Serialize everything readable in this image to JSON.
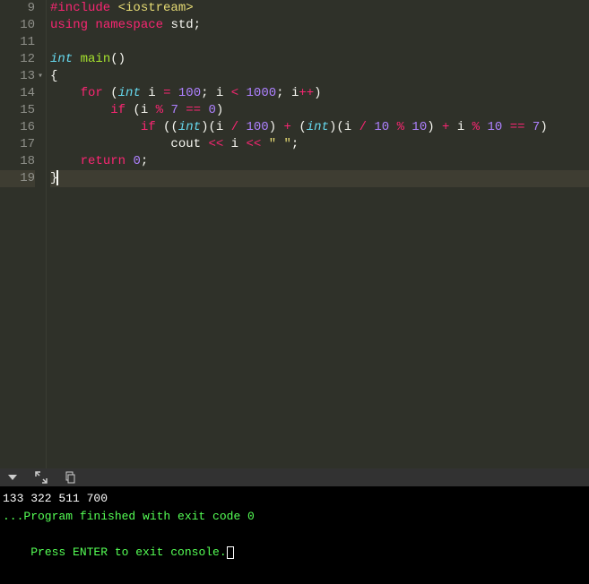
{
  "editor": {
    "lines": [
      {
        "num": "9",
        "tokens": [
          [
            "tok-preproc",
            "#include "
          ],
          [
            "tok-include",
            "<iostream>"
          ]
        ]
      },
      {
        "num": "10",
        "tokens": [
          [
            "tok-keyword2",
            "using"
          ],
          [
            "tok-punct",
            " "
          ],
          [
            "tok-keyword2",
            "namespace"
          ],
          [
            "tok-punct",
            " "
          ],
          [
            "tok-ident",
            "std"
          ],
          [
            "tok-punct",
            ";"
          ]
        ]
      },
      {
        "num": "11",
        "tokens": []
      },
      {
        "num": "12",
        "tokens": [
          [
            "tok-type",
            "int"
          ],
          [
            "tok-punct",
            " "
          ],
          [
            "tok-func",
            "main"
          ],
          [
            "tok-punct",
            "()"
          ]
        ]
      },
      {
        "num": "13",
        "fold": true,
        "tokens": [
          [
            "tok-punct",
            "{"
          ]
        ]
      },
      {
        "num": "14",
        "tokens": [
          [
            "tok-punct",
            "    "
          ],
          [
            "tok-keyword2",
            "for"
          ],
          [
            "tok-punct",
            " ("
          ],
          [
            "tok-type",
            "int"
          ],
          [
            "tok-punct",
            " i "
          ],
          [
            "tok-operator",
            "="
          ],
          [
            "tok-punct",
            " "
          ],
          [
            "tok-number",
            "100"
          ],
          [
            "tok-punct",
            "; i "
          ],
          [
            "tok-operator",
            "<"
          ],
          [
            "tok-punct",
            " "
          ],
          [
            "tok-number",
            "1000"
          ],
          [
            "tok-punct",
            "; i"
          ],
          [
            "tok-operator",
            "++"
          ],
          [
            "tok-punct",
            ")"
          ]
        ]
      },
      {
        "num": "15",
        "tokens": [
          [
            "tok-punct",
            "        "
          ],
          [
            "tok-keyword2",
            "if"
          ],
          [
            "tok-punct",
            " (i "
          ],
          [
            "tok-operator",
            "%"
          ],
          [
            "tok-punct",
            " "
          ],
          [
            "tok-number",
            "7"
          ],
          [
            "tok-punct",
            " "
          ],
          [
            "tok-operator",
            "=="
          ],
          [
            "tok-punct",
            " "
          ],
          [
            "tok-number",
            "0"
          ],
          [
            "tok-punct",
            ")"
          ]
        ]
      },
      {
        "num": "16",
        "tokens": [
          [
            "tok-punct",
            "            "
          ],
          [
            "tok-keyword2",
            "if"
          ],
          [
            "tok-punct",
            " (("
          ],
          [
            "tok-type",
            "int"
          ],
          [
            "tok-punct",
            ")(i "
          ],
          [
            "tok-operator",
            "/"
          ],
          [
            "tok-punct",
            " "
          ],
          [
            "tok-number",
            "100"
          ],
          [
            "tok-punct",
            ") "
          ],
          [
            "tok-operator",
            "+"
          ],
          [
            "tok-punct",
            " ("
          ],
          [
            "tok-type",
            "int"
          ],
          [
            "tok-punct",
            ")(i "
          ],
          [
            "tok-operator",
            "/"
          ],
          [
            "tok-punct",
            " "
          ],
          [
            "tok-number",
            "10"
          ],
          [
            "tok-punct",
            " "
          ],
          [
            "tok-operator",
            "%"
          ],
          [
            "tok-punct",
            " "
          ],
          [
            "tok-number",
            "10"
          ],
          [
            "tok-punct",
            ") "
          ],
          [
            "tok-operator",
            "+"
          ],
          [
            "tok-punct",
            " i "
          ],
          [
            "tok-operator",
            "%"
          ],
          [
            "tok-punct",
            " "
          ],
          [
            "tok-number",
            "10"
          ],
          [
            "tok-punct",
            " "
          ],
          [
            "tok-operator",
            "=="
          ],
          [
            "tok-punct",
            " "
          ],
          [
            "tok-number",
            "7"
          ],
          [
            "tok-punct",
            ")"
          ]
        ]
      },
      {
        "num": "17",
        "tokens": [
          [
            "tok-punct",
            "                cout "
          ],
          [
            "tok-operator",
            "<<"
          ],
          [
            "tok-punct",
            " i "
          ],
          [
            "tok-operator",
            "<<"
          ],
          [
            "tok-punct",
            " "
          ],
          [
            "tok-string",
            "\" \""
          ],
          [
            "tok-punct",
            ";"
          ]
        ]
      },
      {
        "num": "18",
        "tokens": [
          [
            "tok-punct",
            "    "
          ],
          [
            "tok-keyword2",
            "return"
          ],
          [
            "tok-punct",
            " "
          ],
          [
            "tok-number",
            "0"
          ],
          [
            "tok-punct",
            ";"
          ]
        ]
      },
      {
        "num": "19",
        "active": true,
        "cursor": true,
        "tokens": [
          [
            "tok-punct",
            "}"
          ]
        ]
      }
    ]
  },
  "console": {
    "output": "133 322 511 700",
    "blank": "",
    "finished": "...Program finished with exit code 0",
    "prompt": "Press ENTER to exit console."
  }
}
